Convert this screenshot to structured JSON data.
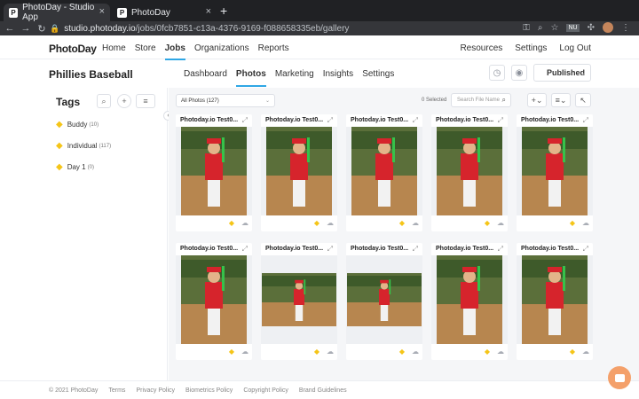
{
  "browser": {
    "tabs": [
      {
        "title": "PhotoDay - Studio App",
        "active": true
      },
      {
        "title": "PhotoDay",
        "active": false
      }
    ],
    "url_host": "studio.photoday.io",
    "url_path": "/jobs/0fcb7851-c13a-4376-9169-f088658335eb/gallery",
    "profile_badge": "NU"
  },
  "app": {
    "logo": "PhotoDay",
    "nav": [
      "Home",
      "Store",
      "Jobs",
      "Organizations",
      "Reports"
    ],
    "active_nav": "Jobs",
    "right_nav": [
      "Resources",
      "Settings",
      "Log Out"
    ],
    "accent": "#2fa7e5"
  },
  "job": {
    "title": "Phillies Baseball",
    "subnav": [
      "Dashboard",
      "Photos",
      "Marketing",
      "Insights",
      "Settings"
    ],
    "active_subnav": "Photos",
    "status": "Published"
  },
  "sidebar": {
    "title": "Tags",
    "tags": [
      {
        "label": "Buddy",
        "count": "(10)"
      },
      {
        "label": "Individual",
        "count": "(117)"
      },
      {
        "label": "Day 1",
        "count": "(0)"
      }
    ]
  },
  "toolbar": {
    "filter": "All Photos (127)",
    "selected": "0 Selected",
    "search_placeholder": "Search File Name"
  },
  "photos": [
    {
      "title": "Photoday.io Test0...",
      "orientation": "portrait"
    },
    {
      "title": "Photoday.io Test0...",
      "orientation": "portrait"
    },
    {
      "title": "Photoday.io Test0...",
      "orientation": "portrait"
    },
    {
      "title": "Photoday.io Test0...",
      "orientation": "portrait"
    },
    {
      "title": "Photoday.io Test0...",
      "orientation": "portrait"
    },
    {
      "title": "Photoday.io Test0...",
      "orientation": "portrait"
    },
    {
      "title": "Photoday.io Test0...",
      "orientation": "landscape"
    },
    {
      "title": "Photoday.io Test0...",
      "orientation": "landscape"
    },
    {
      "title": "Photoday.io Test0...",
      "orientation": "portrait"
    },
    {
      "title": "Photoday.io Test0...",
      "orientation": "portrait"
    }
  ],
  "footer": [
    "© 2021 PhotoDay",
    "Terms",
    "Privacy Policy",
    "Biometrics Policy",
    "Copyright Policy",
    "Brand Guidelines"
  ]
}
